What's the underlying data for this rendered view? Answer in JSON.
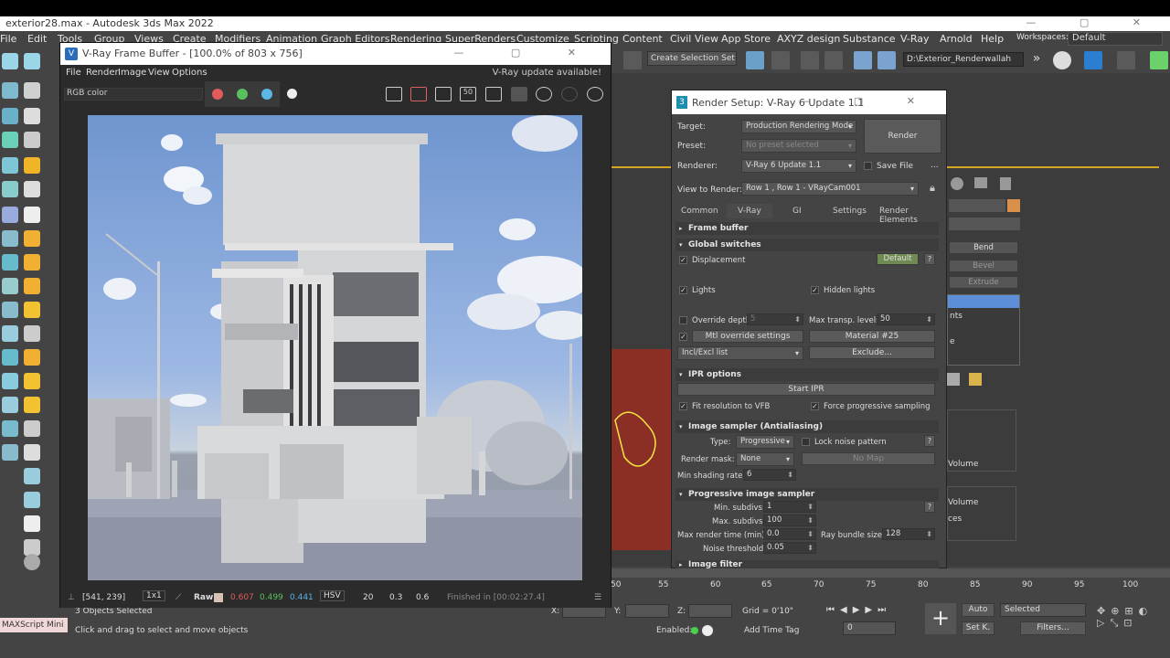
{
  "app": {
    "window_title": "exterior28.max - Autodesk 3ds Max 2022"
  },
  "menu": {
    "items": [
      "File",
      "Edit",
      "Tools",
      "Group",
      "Views",
      "Create",
      "Modifiers",
      "Animation",
      "Graph Editors",
      "Rendering",
      "SuperRenders",
      "Customize",
      "Scripting",
      "Content",
      "Civil View",
      "App Store",
      "AXYZ design",
      "Substance",
      "V-Ray",
      "Arnold",
      "Help"
    ],
    "workspaces_label": "Workspaces:",
    "workspace_value": "Default"
  },
  "toolbar": {
    "selection_set": "Create Selection Set",
    "project_path": "D:\\Exterior_Renderwallah"
  },
  "vfb": {
    "title": "V-Ray Frame Buffer - [100.0% of 803 x 756]",
    "menu": [
      "File",
      "Render",
      "Image",
      "View",
      "Options"
    ],
    "update_notice": "V-Ray update available!",
    "channel": "RGB color",
    "channel_colors": [
      "#e15b5b",
      "#58c05c",
      "#5ab8e6"
    ],
    "coords": "[541, 239]",
    "zoom": "1x1",
    "raw_label": "Raw",
    "r_value": "0.607",
    "g_value": "0.499",
    "b_value": "0.441",
    "color_mode": "HSV",
    "v1": "20",
    "v2": "0.3",
    "v3": "0.6",
    "status": "Finished in [00:02:27.4]"
  },
  "render_setup": {
    "title": "Render Setup: V-Ray 6 Update 1.1",
    "target_label": "Target:",
    "target_value": "Production Rendering Mode",
    "preset_label": "Preset:",
    "preset_value": "No preset selected",
    "renderer_label": "Renderer:",
    "renderer_value": "V-Ray 6 Update 1.1",
    "save_file": "Save File",
    "view_label": "View to Render:",
    "view_value": "Row 1 , Row 1 - VRayCam001",
    "render_button": "Render",
    "tabs": [
      "Common",
      "V-Ray",
      "GI",
      "Settings",
      "Render Elements"
    ],
    "frame_buffer": "Frame buffer",
    "global_switches": "Global switches",
    "displacement": "Displacement",
    "default_btn": "Default",
    "lights": "Lights",
    "hidden_lights": "Hidden lights",
    "override_depth": "Override depth",
    "override_depth_value": "5",
    "max_transp": "Max transp. levels",
    "max_transp_value": "50",
    "mtl_override": "Mtl override settings",
    "material": "Material #25",
    "incl_excl": "Incl/Excl list",
    "exclude": "Exclude...",
    "ipr_options": "IPR options",
    "start_ipr": "Start IPR",
    "fit_resolution": "Fit resolution to VFB",
    "force_progressive": "Force progressive sampling",
    "image_sampler": "Image sampler (Antialiasing)",
    "type_label": "Type:",
    "type_value": "Progressive",
    "lock_noise": "Lock noise pattern",
    "render_mask_label": "Render mask:",
    "render_mask_value": "None",
    "no_map": "No Map",
    "min_shading_label": "Min shading rate:",
    "min_shading_value": "6",
    "progressive_sampler": "Progressive image sampler",
    "min_subdivs_label": "Min. subdivs:",
    "min_subdivs_value": "1",
    "max_subdivs_label": "Max. subdivs:",
    "max_subdivs_value": "100",
    "max_render_time_label": "Max render time (min):",
    "max_render_time_value": "0.0",
    "ray_bundle_label": "Ray bundle size:",
    "ray_bundle_value": "128",
    "noise_threshold_label": "Noise threshold:",
    "noise_threshold_value": "0.05",
    "image_filter": "Image filter"
  },
  "command_panel": {
    "buttons": [
      "Bend",
      "Bevel",
      "Extrude"
    ],
    "list_items": [
      "nts",
      "e"
    ],
    "volume1": "Volume",
    "volume2": "Volume",
    "ces": "ces"
  },
  "timeline": {
    "ticks": [
      "50",
      "55",
      "60",
      "65",
      "70",
      "75",
      "80",
      "85",
      "90",
      "95",
      "100"
    ]
  },
  "status_bar": {
    "selected": "3 Objects Selected",
    "prompt": "Click and drag to select and move objects",
    "script_label": "MAXScript Mini",
    "x_label": "X:",
    "y_label": "Y:",
    "z_label": "Z:",
    "grid": "Grid = 0'10\"",
    "enabled_label": "Enabled:",
    "add_time_tag": "Add Time Tag",
    "auto_btn": "Auto",
    "selected_dropdown": "Selected",
    "set_key": "Set K.",
    "filters": "Filters...",
    "frame_value": "0"
  }
}
